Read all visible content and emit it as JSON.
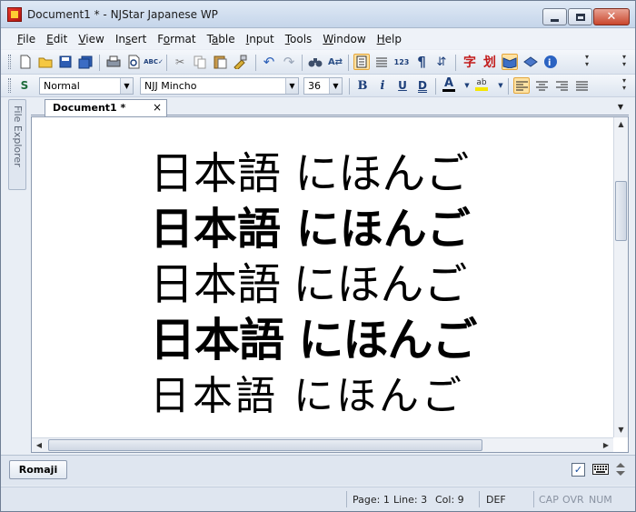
{
  "window": {
    "title": "Document1 * - NJStar Japanese WP"
  },
  "menu": {
    "items": [
      {
        "pre": "",
        "acc": "F",
        "post": "ile"
      },
      {
        "pre": "",
        "acc": "E",
        "post": "dit"
      },
      {
        "pre": "",
        "acc": "V",
        "post": "iew"
      },
      {
        "pre": "In",
        "acc": "s",
        "post": "ert"
      },
      {
        "pre": "F",
        "acc": "o",
        "post": "rmat"
      },
      {
        "pre": "T",
        "acc": "a",
        "post": "ble"
      },
      {
        "pre": "",
        "acc": "I",
        "post": "nput"
      },
      {
        "pre": "",
        "acc": "T",
        "post": "ools"
      },
      {
        "pre": "",
        "acc": "W",
        "post": "indow"
      },
      {
        "pre": "",
        "acc": "H",
        "post": "elp"
      }
    ]
  },
  "format_toolbar": {
    "style": "Normal",
    "font": "NJJ Mincho",
    "size": "36"
  },
  "side_panel": {
    "label": "File Explorer"
  },
  "document_tab": {
    "label": "Document1 *",
    "close": "×"
  },
  "document": {
    "lines": [
      "日本語 にほんご",
      "日本語 にほんご",
      "日本語 にほんご",
      "日本語 にほんご",
      "日本語 にほんご"
    ]
  },
  "input_bar": {
    "mode": "Romaji"
  },
  "status": {
    "page": "Page: 1",
    "line": "Line: 3",
    "col": "Col: 9",
    "def": "DEF",
    "cap": "CAP",
    "ovr": "OVR",
    "num": "NUM"
  },
  "icons": {
    "toolbar1": [
      "new-icon",
      "open-icon",
      "save-icon",
      "save-all-icon",
      "print-icon",
      "print-preview-icon",
      "spellcheck-icon",
      "cut-icon",
      "copy-icon",
      "paste-icon",
      "format-painter-icon",
      "undo-icon",
      "redo-icon",
      "find-icon",
      "replace-icon",
      "view-normal-icon",
      "view-lines-icon",
      "line-numbers-icon",
      "pilcrow-icon",
      "text-direction-icon",
      "character-icon",
      "stroke-order-icon",
      "dictionary-icon",
      "book-icon",
      "help-icon"
    ],
    "toolbar2": [
      "style-icon",
      "bold-icon",
      "italic-icon",
      "underline-icon",
      "double-underline-icon",
      "font-color-icon",
      "highlight-icon",
      "align-left-icon",
      "align-center-icon",
      "align-right-icon",
      "justify-icon"
    ]
  },
  "colors": {
    "accent": "#1d3f7a",
    "selected": "#fde2a3",
    "font_color_bar": "#000000",
    "highlight_bar": "#f5e600"
  }
}
